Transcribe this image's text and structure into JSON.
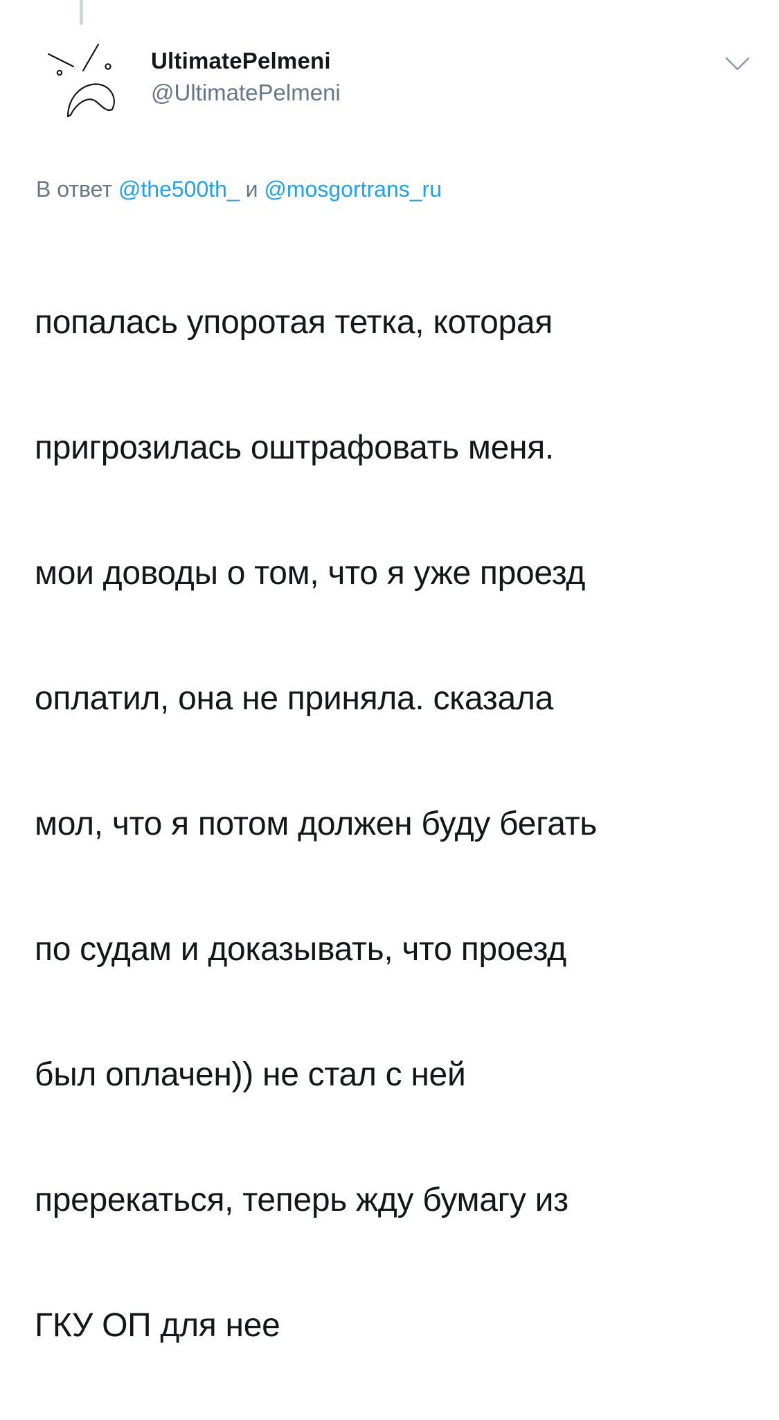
{
  "tweet": {
    "author": {
      "display_name": "UltimatePelmeni",
      "handle": "@UltimatePelmeni",
      "avatar_icon": "angry-face-doodle-icon"
    },
    "menu_icon": "chevron-down-icon",
    "reply": {
      "prefix": "В ответ",
      "mention_1": "@the500th_",
      "conjunction": "и",
      "mention_2": "@mosgortrans_ru"
    },
    "text_lines": [
      "попалась упоротая тетка, которая",
      "пригрозилась оштрафовать меня.",
      "мои доводы о том, что я уже проезд",
      "оплатил, она не приняла. сказала",
      "мол, что я потом должен буду бегать",
      "по судам и доказывать, что проезд",
      "был оплачен)) не стал с ней",
      "пререкаться, теперь жду бумагу из",
      "ГКУ ОП для нее"
    ]
  },
  "colors": {
    "text": "#14171a",
    "secondary": "#657786",
    "link": "#1da1f2",
    "thread_line": "#ccd6dd"
  }
}
